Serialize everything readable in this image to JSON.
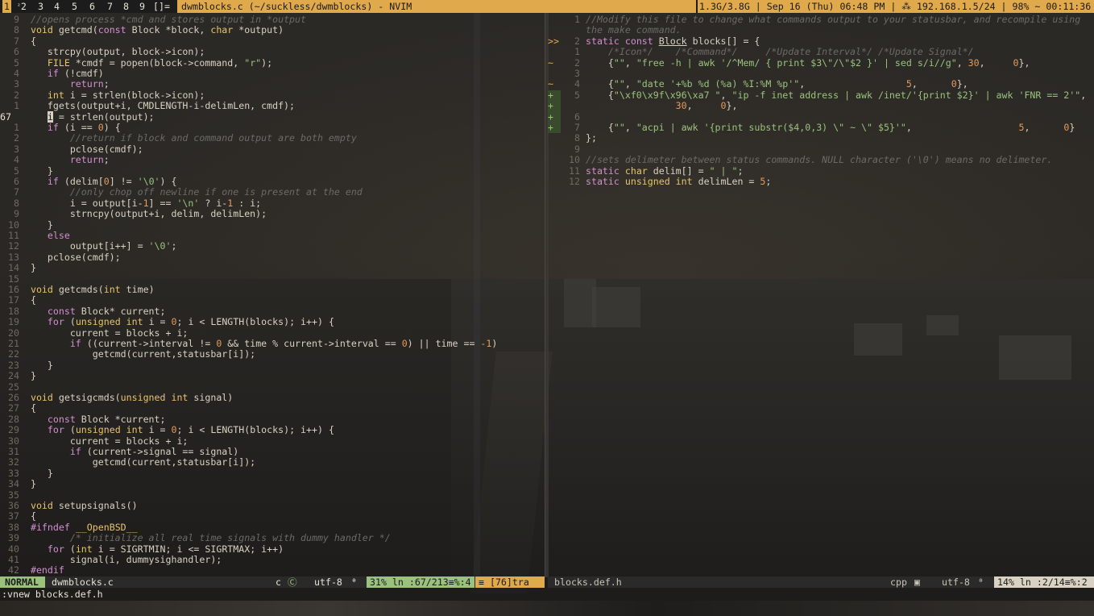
{
  "topbar": {
    "workspaces": [
      "1",
      "2",
      "3",
      "4",
      "5",
      "6",
      "7",
      "8",
      "9"
    ],
    "selected_workspace": "1",
    "workspace_2_marker": "²",
    "layout": "[]=",
    "window_title": "dwmblocks.c (~/suckless/dwmblocks) - NVIM",
    "status": "1.3G/3.8G | Sep 16 (Thu) 06:48 PM | ⁂ 192.168.1.5/24 | 98% ~ 00:11:36"
  },
  "left_buffer": {
    "lines": [
      {
        "num": "9",
        "html": "<span class=\"cm\">//opens process *cmd and stores output in *output</span>"
      },
      {
        "num": "8",
        "html": "<span class=\"ty\">void</span> getcmd(<span class=\"kw\">const</span> Block *block, <span class=\"ty\">char</span> *output)"
      },
      {
        "num": "7",
        "html": "{"
      },
      {
        "num": "6",
        "html": "    strcpy(output, block->icon);"
      },
      {
        "num": "5",
        "html": "    <span class=\"ty\">FILE</span> *cmdf = popen(block->command, <span class=\"st\">\"r\"</span>);"
      },
      {
        "num": "4",
        "html": "    <span class=\"kw\">if</span> (!cmdf)"
      },
      {
        "num": "3",
        "html": "        <span class=\"kw\">return</span>;"
      },
      {
        "num": "2",
        "html": "    <span class=\"ty\">int</span> i = strlen(block->icon);"
      },
      {
        "num": "1",
        "html": "    fgets(output+i, CMDLENGTH-i-delimLen, cmdf);"
      },
      {
        "num": "67",
        "current": true,
        "html": "    <span class=\"cur-block\">i</span> = strlen(output);"
      },
      {
        "num": "1",
        "html": "    <span class=\"kw\">if</span> (i == <span class=\"nu\">0</span>) {"
      },
      {
        "num": "2",
        "html": "        <span class=\"cm\">//return if block and command output are both empty</span>"
      },
      {
        "num": "3",
        "html": "        pclose(cmdf);"
      },
      {
        "num": "4",
        "html": "        <span class=\"kw\">return</span>;"
      },
      {
        "num": "5",
        "html": "    }"
      },
      {
        "num": "6",
        "html": "    <span class=\"kw\">if</span> (delim[<span class=\"nu\">0</span>] != <span class=\"st\">'\\0'</span>) {"
      },
      {
        "num": "7",
        "html": "        <span class=\"cm\">//only chop off newline if one is present at the end</span>"
      },
      {
        "num": "8",
        "html": "        i = output[i-<span class=\"nu\">1</span>] == <span class=\"st\">'\\n'</span> ? i-<span class=\"nu\">1</span> : i;"
      },
      {
        "num": "9",
        "html": "        strncpy(output+i, delim, delimLen);"
      },
      {
        "num": "10",
        "html": "    }"
      },
      {
        "num": "11",
        "html": "    <span class=\"kw\">else</span>"
      },
      {
        "num": "12",
        "html": "        output[i++] = <span class=\"st\">'\\0'</span>;"
      },
      {
        "num": "13",
        "html": "    pclose(cmdf);"
      },
      {
        "num": "14",
        "html": "}"
      },
      {
        "num": "15",
        "html": ""
      },
      {
        "num": "16",
        "html": "<span class=\"ty\">void</span> getcmds(<span class=\"ty\">int</span> time)"
      },
      {
        "num": "17",
        "html": "{"
      },
      {
        "num": "18",
        "html": "    <span class=\"kw\">const</span> Block* current;"
      },
      {
        "num": "19",
        "html": "    <span class=\"kw\">for</span> (<span class=\"ty\">unsigned int</span> i = <span class=\"nu\">0</span>; i < LENGTH(blocks); i++) {"
      },
      {
        "num": "20",
        "html": "        current = blocks + i;"
      },
      {
        "num": "21",
        "html": "        <span class=\"kw\">if</span> ((current->interval != <span class=\"nu\">0</span> && time % current->interval == <span class=\"nu\">0</span>) || time == <span class=\"nu\">-1</span>)"
      },
      {
        "num": "22",
        "html": "            getcmd(current,statusbar[i]);"
      },
      {
        "num": "23",
        "html": "    }"
      },
      {
        "num": "24",
        "html": "}"
      },
      {
        "num": "25",
        "html": ""
      },
      {
        "num": "26",
        "html": "<span class=\"ty\">void</span> getsigcmds(<span class=\"ty\">unsigned int</span> signal)"
      },
      {
        "num": "27",
        "html": "{"
      },
      {
        "num": "28",
        "html": "    <span class=\"kw\">const</span> Block *current;"
      },
      {
        "num": "29",
        "html": "    <span class=\"kw\">for</span> (<span class=\"ty\">unsigned int</span> i = <span class=\"nu\">0</span>; i < LENGTH(blocks); i++) {"
      },
      {
        "num": "30",
        "html": "        current = blocks + i;"
      },
      {
        "num": "31",
        "html": "        <span class=\"kw\">if</span> (current->signal == signal)"
      },
      {
        "num": "32",
        "html": "            getcmd(current,statusbar[i]);"
      },
      {
        "num": "33",
        "html": "    }"
      },
      {
        "num": "34",
        "html": "}"
      },
      {
        "num": "35",
        "html": ""
      },
      {
        "num": "36",
        "html": "<span class=\"ty\">void</span> setupsignals()"
      },
      {
        "num": "37",
        "html": "{"
      },
      {
        "num": "38",
        "html": "<span class=\"pp\">#ifndef</span> <span class=\"ty\">__OpenBSD__</span>"
      },
      {
        "num": "39",
        "html": "        <span class=\"cm\">/* initialize all real time signals with dummy handler */</span>"
      },
      {
        "num": "40",
        "html": "    <span class=\"kw\">for</span> (<span class=\"ty\">int</span> i = SIGRTMIN; i <= SIGRTMAX; i++)"
      },
      {
        "num": "41",
        "html": "        signal(i, dummysighandler);"
      },
      {
        "num": "42",
        "html": "<span class=\"pp\">#endif</span>"
      }
    ]
  },
  "right_buffer": {
    "lines": [
      {
        "num": "1",
        "sign": "",
        "html": "<span class=\"cm\">//Modify this file to change what commands output to your statusbar, and recompile using</span>"
      },
      {
        "num": "",
        "sign": "",
        "html": "<span class=\"cm\">the make command.</span>"
      },
      {
        "num": "2",
        "sign": ">>",
        "html": "<span class=\"kw\">static</span> <span class=\"kw\">const</span> <span class=\"und\">Block</span> blocks[] = {"
      },
      {
        "num": "1",
        "sign": "",
        "html": "    <span class=\"cm\">/*Icon*/    /*Command*/     /*Update Interval*/ /*Update Signal*/</span>"
      },
      {
        "num": "2",
        "sign": "~",
        "html": "    {<span class=\"st\">\"\"</span>, <span class=\"st\">\"free -h | awk '/^Mem/ { print $3\\\"/\\\"$2 }' | sed s/i//g\"</span>, <span class=\"nu\">30</span>,     <span class=\"nu\">0</span>},"
      },
      {
        "num": "3",
        "sign": "",
        "html": ""
      },
      {
        "num": "4",
        "sign": "~",
        "html": "    {<span class=\"st\">\"\"</span>, <span class=\"st\">\"date '+%b %d (%a) %I:%M %p'\"</span>,                  <span class=\"nu\">5</span>,      <span class=\"nu\">0</span>},"
      },
      {
        "num": "5",
        "sign": "+",
        "html": "    {<span class=\"st\">\"\\xf0\\x9f\\x96\\xa7 \"</span>, <span class=\"st\">\"ip -f inet address | awk /inet/'{print $2}' | awk 'FNR == 2'\"</span>,"
      },
      {
        "num": "",
        "sign": "+",
        "html": "                <span class=\"nu\">30</span>,     <span class=\"nu\">0</span>},"
      },
      {
        "num": "6",
        "sign": "+",
        "html": ""
      },
      {
        "num": "7",
        "sign": "+",
        "html": "    {<span class=\"st\">\"\"</span>, <span class=\"st\">\"acpi | awk '{print substr($4,0,3) \\\" ~ \\\" $5}'\"</span>,                   <span class=\"nu\">5</span>,      <span class=\"nu\">0</span>}"
      },
      {
        "num": "8",
        "sign": "",
        "html": "};"
      },
      {
        "num": "9",
        "sign": "",
        "html": ""
      },
      {
        "num": "10",
        "sign": "",
        "html": "<span class=\"cm\">//sets delimeter between status commands. NULL character ('\\0') means no delimeter.</span>"
      },
      {
        "num": "11",
        "sign": "",
        "html": "<span class=\"kw\">static</span> <span class=\"ty\">char</span> delim[] = <span class=\"st\">\" | \"</span>;"
      },
      {
        "num": "12",
        "sign": "",
        "html": "<span class=\"kw\">static</span> <span class=\"ty\">unsigned int</span> delimLen = <span class=\"nu\">5</span>;"
      }
    ]
  },
  "left_statusline": {
    "mode": "NORMAL",
    "filename": "dwmblocks.c",
    "filetype": "c",
    "filetype_icon": "Ⓒ",
    "encoding": "utf-8",
    "encoding_icon": "ᶿ",
    "position": "31% ln :67/213≡%:4",
    "extra": "≡ [76]tra"
  },
  "right_statusline": {
    "filename": "blocks.def.h",
    "filetype": "cpp",
    "filetype_icon": "▣",
    "encoding": "utf-8",
    "encoding_icon": "ᶿ",
    "position": "14% ln :2/14≡%:2"
  },
  "cmdline": ":vnew blocks.def.h",
  "colors": {
    "accent": "#e0a94c",
    "mode_bg": "#9ac27d",
    "background": "#2a2824"
  }
}
